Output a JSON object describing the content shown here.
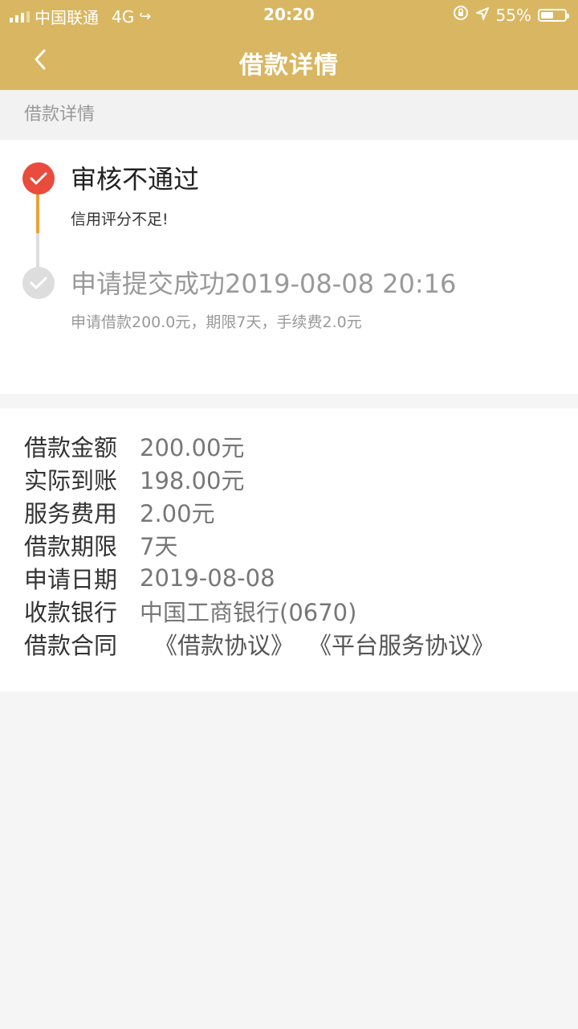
{
  "status_bar": {
    "carrier": "中国联通",
    "network": "4G",
    "time": "20:20",
    "battery_percent_text": "55%",
    "battery_level": 0.55
  },
  "nav": {
    "title": "借款详情"
  },
  "section_label": "借款详情",
  "timeline": [
    {
      "title": "审核不通过",
      "desc": "信用评分不足!",
      "status": "rejected",
      "color": "#e94b3c"
    },
    {
      "title": "申请提交成功2019-08-08 20:16",
      "desc": "申请借款200.0元，期限7天，手续费2.0元",
      "status": "done",
      "color": "#dddddd"
    }
  ],
  "details": {
    "amount": {
      "label": "借款金额",
      "value": "200.00元"
    },
    "received": {
      "label": "实际到账",
      "value": "198.00元"
    },
    "fee": {
      "label": "服务费用",
      "value": "2.00元"
    },
    "term": {
      "label": "借款期限",
      "value": "7天"
    },
    "date": {
      "label": "申请日期",
      "value": "2019-08-08"
    },
    "bank": {
      "label": "收款银行",
      "value": "中国工商银行(0670)"
    },
    "contract": {
      "label": "借款合同",
      "links": [
        "《借款协议》",
        "《平台服务协议》"
      ]
    }
  },
  "colors": {
    "header": "#d9b661",
    "accent_line": "#e6a13a",
    "rejected": "#e94b3c"
  }
}
